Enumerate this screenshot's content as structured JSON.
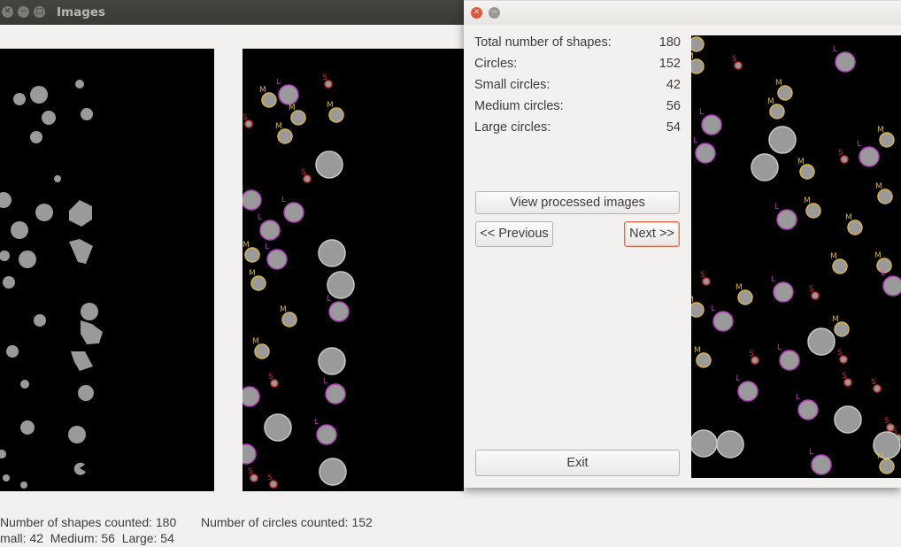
{
  "back_window": {
    "title": "Images",
    "stats_line1_a": "Number of shapes counted: 180",
    "stats_line1_b": "Number of circles counted: 152",
    "stats_line2": "mall: 42  Medium: 56  Large: 54"
  },
  "front_window": {
    "summary": [
      {
        "label": "Total number of shapes:",
        "value": "180"
      },
      {
        "label": "Circles:",
        "value": "152"
      },
      {
        "label": "Small circles:",
        "value": "42"
      },
      {
        "label": "Medium circles:",
        "value": "56"
      },
      {
        "label": "Large circles:",
        "value": "54"
      }
    ],
    "buttons": {
      "view_processed": "View processed images",
      "previous": "<< Previous",
      "next": "Next >>",
      "exit": "Exit"
    }
  },
  "marker_letters": {
    "small": "S",
    "medium": "M",
    "large": "L"
  },
  "colors": {
    "shape_fill": "#9a9a9a",
    "small_outline": "#c2302c",
    "medium_outline": "#d8b24a",
    "large_outline": "#b03cb8",
    "unclassified_outline": "#c8c8c8",
    "focus_border": "#e07050"
  },
  "window_icons": {
    "close": "close-icon",
    "minimize": "minimize-icon",
    "maximize": "maximize-icon"
  }
}
